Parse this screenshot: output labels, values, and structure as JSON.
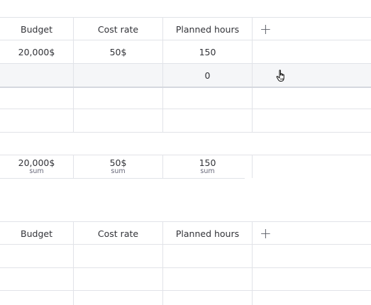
{
  "table1": {
    "columns": [
      "Budget",
      "Cost rate",
      "Planned hours"
    ],
    "add_column_icon": "plus-icon",
    "rows": [
      [
        "20,000$",
        "50$",
        "150"
      ],
      [
        "",
        "",
        "0"
      ],
      [
        "",
        "",
        ""
      ],
      [
        "",
        "",
        ""
      ]
    ]
  },
  "summary": {
    "values": [
      "20,000$",
      "50$",
      "150"
    ],
    "labels": [
      "sum",
      "sum",
      "sum"
    ]
  },
  "table2": {
    "columns": [
      "Budget",
      "Cost rate",
      "Planned hours"
    ],
    "add_column_icon": "plus-icon",
    "rows": [
      [
        "",
        "",
        ""
      ],
      [
        "",
        "",
        ""
      ],
      [
        "",
        "",
        ""
      ]
    ]
  },
  "colors": {
    "hover_row": "#f5f6f8",
    "border": "#e1e3e8",
    "text": "#323338"
  },
  "cursor_icon": "hand-pointer-icon"
}
